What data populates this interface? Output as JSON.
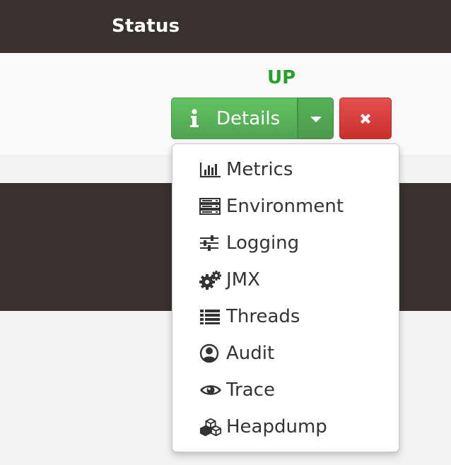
{
  "table": {
    "status_header": "Status"
  },
  "row": {
    "status": "UP",
    "details_label": "Details",
    "details_icon": "info-icon",
    "toggle_icon": "caret-down-icon",
    "remove_icon": "close-icon"
  },
  "colors": {
    "header_bg": "#38312d",
    "status_up": "#2a9d2a",
    "success": "#5cb85c",
    "danger": "#d9534f"
  },
  "dropdown": {
    "items": [
      {
        "label": "Metrics",
        "icon": "bar-chart-icon"
      },
      {
        "label": "Environment",
        "icon": "server-icon"
      },
      {
        "label": "Logging",
        "icon": "sliders-icon"
      },
      {
        "label": "JMX",
        "icon": "gears-icon"
      },
      {
        "label": "Threads",
        "icon": "list-icon"
      },
      {
        "label": "Audit",
        "icon": "user-circle-icon"
      },
      {
        "label": "Trace",
        "icon": "eye-icon"
      },
      {
        "label": "Heapdump",
        "icon": "cubes-icon"
      }
    ]
  }
}
